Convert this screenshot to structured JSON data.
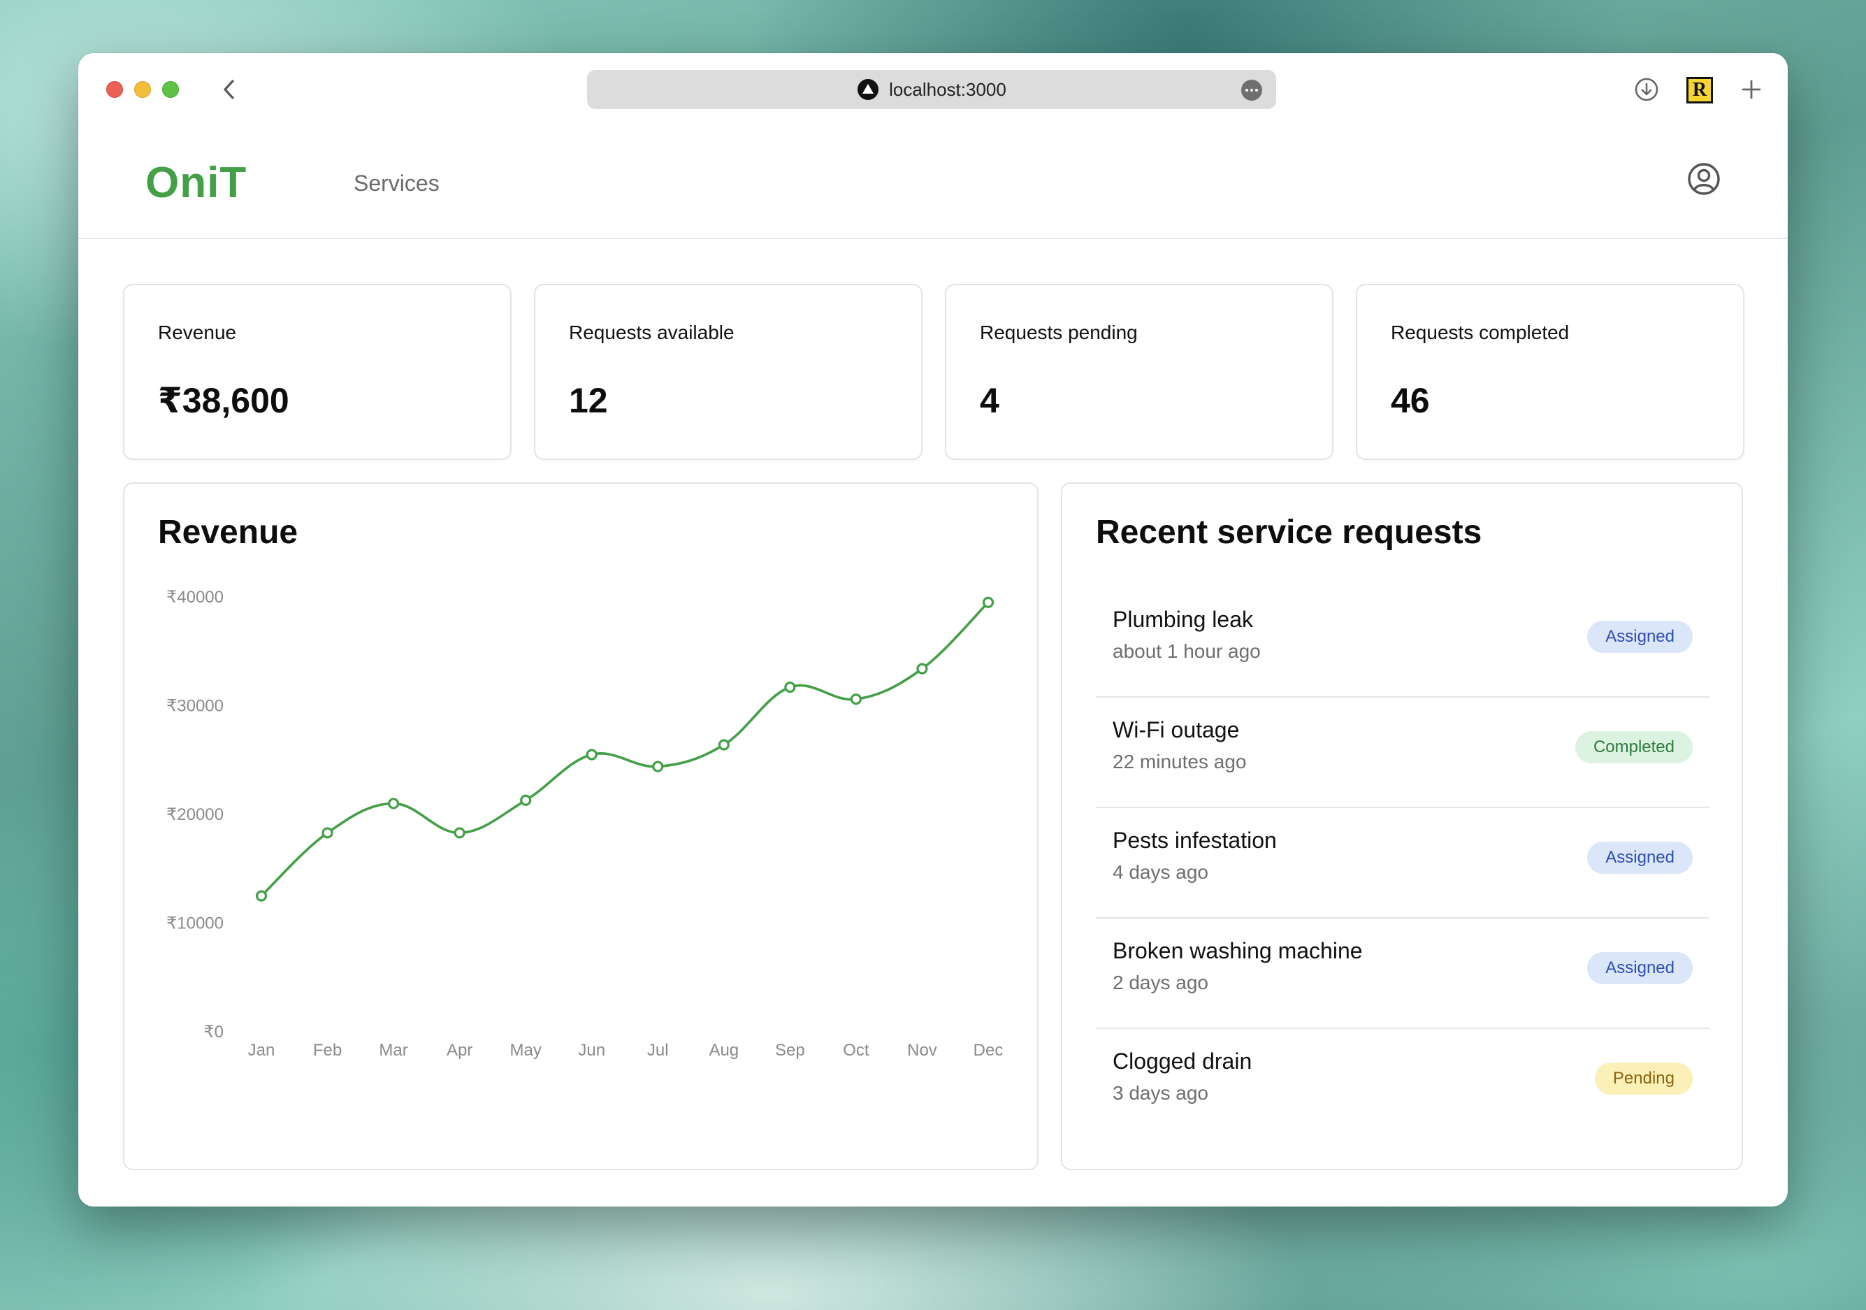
{
  "browser": {
    "url": "localhost:3000"
  },
  "header": {
    "logo": "OniT",
    "nav": [
      {
        "label": "Services"
      }
    ]
  },
  "stats": [
    {
      "label": "Revenue",
      "value": "₹38,600"
    },
    {
      "label": "Requests available",
      "value": "12"
    },
    {
      "label": "Requests pending",
      "value": "4"
    },
    {
      "label": "Requests completed",
      "value": "46"
    }
  ],
  "revenue_panel": {
    "title": "Revenue"
  },
  "chart_data": {
    "type": "line",
    "title": "Revenue",
    "categories": [
      "Jan",
      "Feb",
      "Mar",
      "Apr",
      "May",
      "Jun",
      "Jul",
      "Aug",
      "Sep",
      "Oct",
      "Nov",
      "Dec"
    ],
    "series": [
      {
        "values": [
          12500,
          18300,
          21000,
          18300,
          21300,
          25500,
          24400,
          26400,
          31700,
          30600,
          33400,
          39500
        ]
      }
    ],
    "y_ticks": [
      "₹0",
      "₹10000",
      "₹20000",
      "₹30000",
      "₹40000"
    ],
    "ylim": [
      0,
      40000
    ],
    "color": "#43a047",
    "grid": false,
    "xlabel": "",
    "ylabel": ""
  },
  "requests_panel": {
    "title": "Recent service requests",
    "items": [
      {
        "title": "Plumbing leak",
        "time": "about 1 hour ago",
        "status": "Assigned"
      },
      {
        "title": "Wi-Fi outage",
        "time": "22 minutes ago",
        "status": "Completed"
      },
      {
        "title": "Pests infestation",
        "time": "4 days ago",
        "status": "Assigned"
      },
      {
        "title": "Broken washing machine",
        "time": "2 days ago",
        "status": "Assigned"
      },
      {
        "title": "Clogged drain",
        "time": "3 days ago",
        "status": "Pending"
      }
    ]
  }
}
